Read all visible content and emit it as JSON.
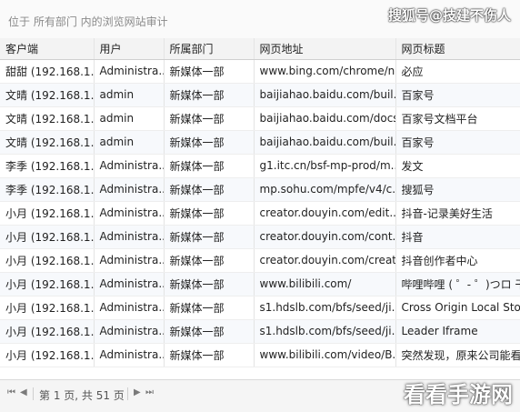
{
  "toolbar": {
    "title": "位于 所有部门 内的浏览网站审计",
    "watermark": "搜狐号@技建不伤人"
  },
  "table": {
    "columns": [
      "客户端",
      "用户",
      "所属部门",
      "网页地址",
      "网页标题"
    ],
    "rows": [
      [
        "甜甜 (192.168.1...",
        "Administra...",
        "新媒体一部",
        "www.bing.com/chrome/n...",
        "必应"
      ],
      [
        "文晴 (192.168.1...",
        "admin",
        "新媒体一部",
        "baijiahao.baidu.com/buil...",
        "百家号"
      ],
      [
        "文晴 (192.168.1...",
        "admin",
        "新媒体一部",
        "baijiahao.baidu.com/docs/...",
        "百家号文档平台"
      ],
      [
        "文晴 (192.168.1...",
        "admin",
        "新媒体一部",
        "baijiahao.baidu.com/buil...",
        "百家号"
      ],
      [
        "李季 (192.168.1...",
        "Administra...",
        "新媒体一部",
        "g1.itc.cn/bsf-mp-prod/m...",
        "发文"
      ],
      [
        "李季 (192.168.1...",
        "Administra...",
        "新媒体一部",
        "mp.sohu.com/mpfe/v4/c...",
        "搜狐号"
      ],
      [
        "小月 (192.168.1...",
        "Administra...",
        "新媒体一部",
        "creator.douyin.com/edit...",
        "抖音-记录美好生活"
      ],
      [
        "小月 (192.168.1...",
        "Administra...",
        "新媒体一部",
        "creator.douyin.com/cont...",
        "抖音"
      ],
      [
        "小月 (192.168.1...",
        "Administra...",
        "新媒体一部",
        "creator.douyin.com/creat...",
        "抖音创作者中心"
      ],
      [
        "小月 (192.168.1...",
        "Administra...",
        "新媒体一部",
        "www.bilibili.com/",
        "哔哩哔哩 ( ゜- ゜)つロ 干杯"
      ],
      [
        "小月 (192.168.1...",
        "Administra...",
        "新媒体一部",
        "s1.hdslb.com/bfs/seed/ji...",
        "Cross Origin Local Storage"
      ],
      [
        "小月 (192.168.1...",
        "Administra...",
        "新媒体一部",
        "s1.hdslb.com/bfs/seed/ji...",
        "Leader Iframe"
      ],
      [
        "小月 (192.168.1...",
        "Administra...",
        "新媒体一部",
        "www.bilibili.com/video/B...",
        "突然发现，原来公司能看到"
      ]
    ]
  },
  "pager": {
    "text": "第 1 页, 共 51 页"
  },
  "logo": "看看手游网"
}
